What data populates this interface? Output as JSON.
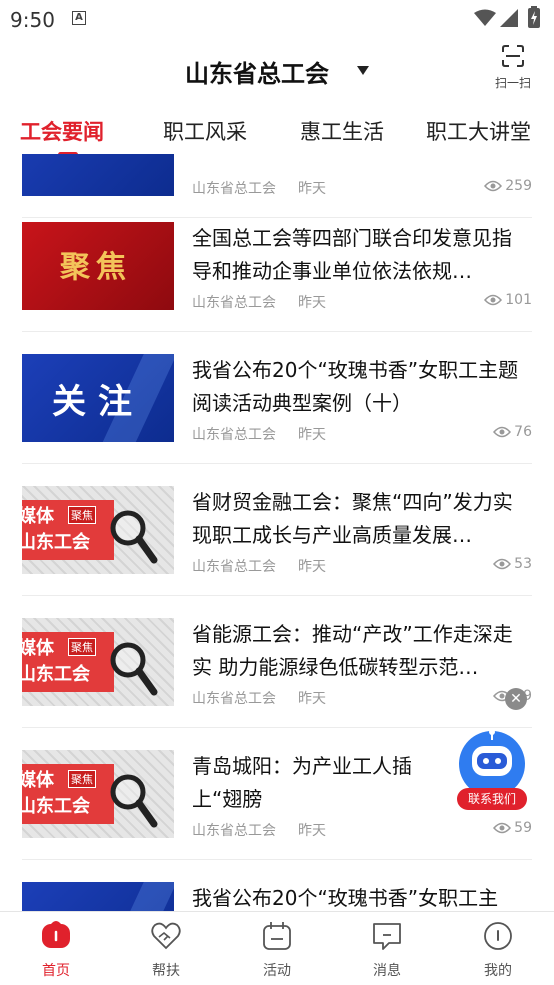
{
  "status_bar": {
    "time": "9:50"
  },
  "header": {
    "title": "山东省总工会",
    "scan_label": "扫一扫"
  },
  "tabs": [
    "工会要闻",
    "职工风采",
    "惠工生活",
    "职工大讲堂"
  ],
  "feed": [
    {
      "thumb": "blue",
      "thumb_text": "",
      "headline": "",
      "source": "山东省总工会",
      "date": "昨天",
      "views": "259"
    },
    {
      "thumb": "red",
      "thumb_text": "聚焦",
      "headline": "全国总工会等四部门联合印发意见指导和推动企事业单位依法依规…",
      "source": "山东省总工会",
      "date": "昨天",
      "views": "101"
    },
    {
      "thumb": "blue",
      "thumb_text": "关注",
      "headline": "我省公布20个“玫瑰书香”女职工主题阅读活动典型案例（十）",
      "source": "山东省总工会",
      "date": "昨天",
      "views": "76"
    },
    {
      "thumb": "media",
      "thumb_line1": "媒体",
      "thumb_line2": "山东工会",
      "thumb_tag": "聚焦",
      "headline": "省财贸金融工会：聚焦“四向”发力实现职工成长与产业高质量发展…",
      "source": "山东省总工会",
      "date": "昨天",
      "views": "53"
    },
    {
      "thumb": "media",
      "thumb_line1": "媒体",
      "thumb_line2": "山东工会",
      "thumb_tag": "聚焦",
      "headline": "省能源工会：推动“产改”工作走深走实 助力能源绿色低碳转型示范…",
      "source": "山东省总工会",
      "date": "昨天",
      "views": "59"
    },
    {
      "thumb": "media",
      "thumb_line1": "媒体",
      "thumb_line2": "山东工会",
      "thumb_tag": "聚焦",
      "headline": "青岛城阳：为产业工人插上“翅膀",
      "source": "山东省总工会",
      "date": "昨天",
      "views": "59"
    },
    {
      "thumb": "blue",
      "thumb_text": "",
      "headline": "我省公布20个“玫瑰书香”女职工主",
      "source": "",
      "date": "",
      "views": ""
    }
  ],
  "float_button": {
    "label": "联系我们"
  },
  "bottom_nav": [
    {
      "label": "首页",
      "icon": "home-icon"
    },
    {
      "label": "帮扶",
      "icon": "heart-hand-icon"
    },
    {
      "label": "活动",
      "icon": "activity-icon"
    },
    {
      "label": "消息",
      "icon": "message-icon"
    },
    {
      "label": "我的",
      "icon": "profile-icon"
    }
  ],
  "colors": {
    "accent": "#e0212c",
    "inactive": "#555555"
  }
}
